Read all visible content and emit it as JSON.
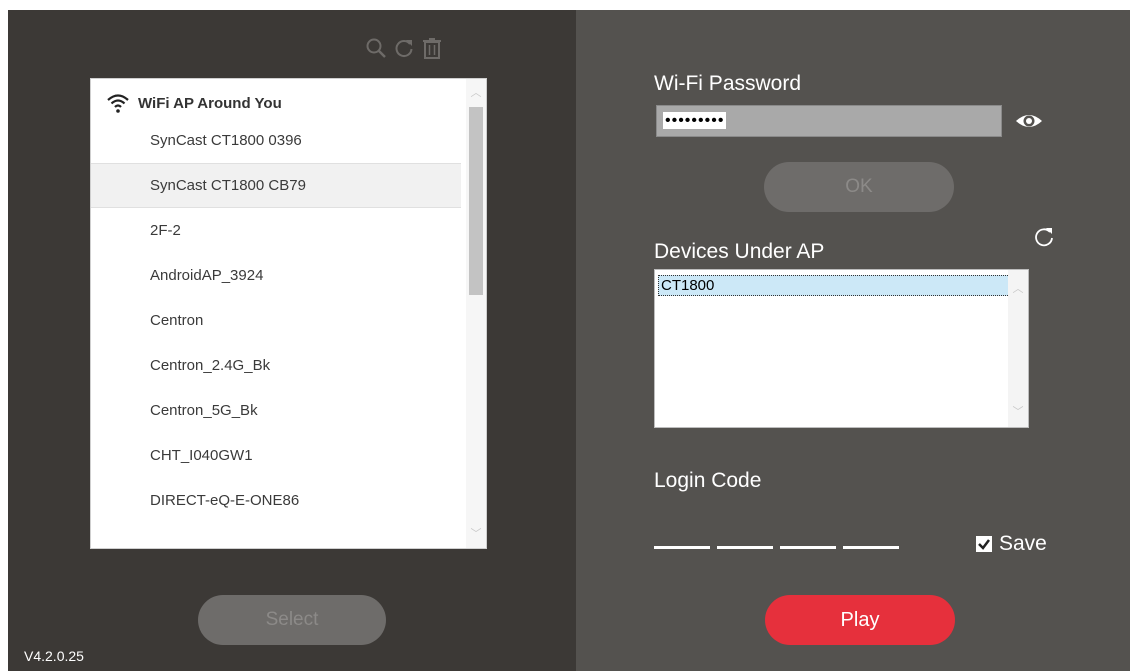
{
  "left_panel": {
    "toolbar_icons": [
      "search-icon",
      "refresh-icon",
      "trash-icon"
    ],
    "wifi_list": {
      "header": "WiFi AP Around You",
      "items": [
        "SynCast CT1800 0396",
        "SynCast CT1800 CB79",
        "2F-2",
        "AndroidAP_3924",
        "Centron",
        "Centron_2.4G_Bk",
        "Centron_5G_Bk",
        "CHT_I040GW1",
        "DIRECT-eQ-E-ONE86"
      ],
      "selected_item": "SynCast CT1800 CB79"
    },
    "select_label": "Select",
    "version": "V4.2.0.25"
  },
  "right_panel": {
    "password_label": "Wi-Fi Password",
    "password_value": "•••••••••",
    "ok_label": "OK",
    "devices_label": "Devices Under AP",
    "devices": [
      "CT1800"
    ],
    "login_code_label": "Login Code",
    "save_label": "Save",
    "save_checked": true,
    "play_label": "Play"
  },
  "colors": {
    "left_bg": "#3c3936",
    "right_bg": "#54524f",
    "play_accent": "#e6303c"
  }
}
